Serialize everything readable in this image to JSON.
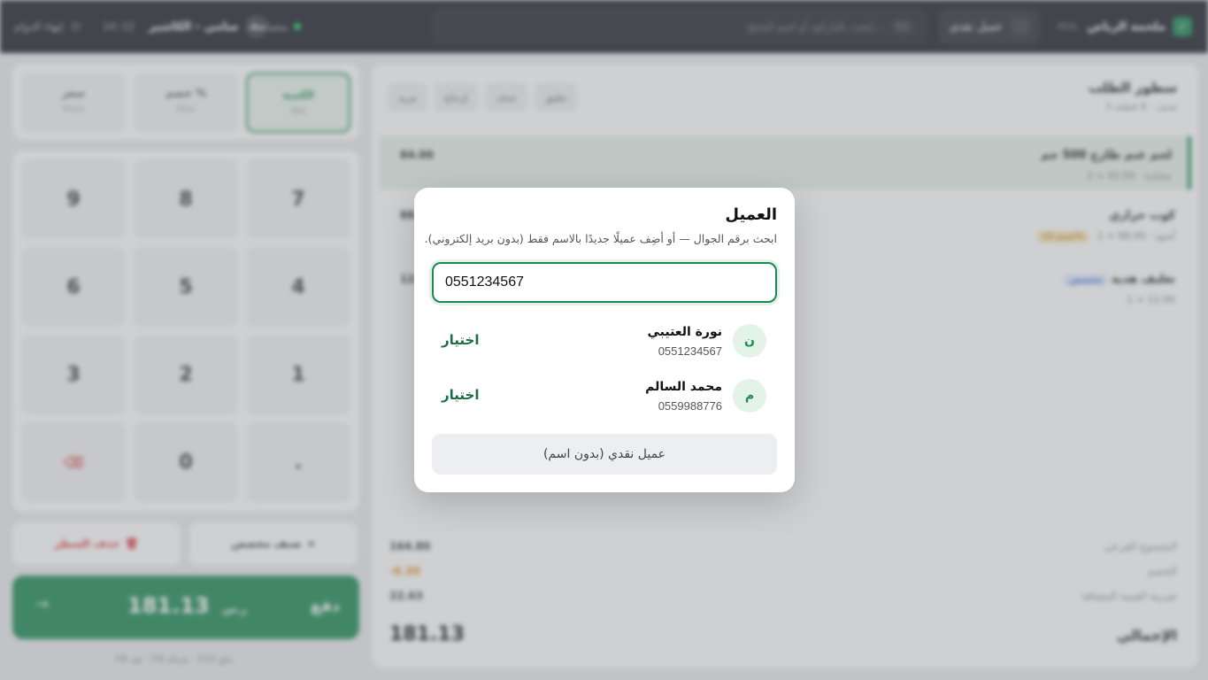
{
  "topbar": {
    "brand_name": "ملحمة الرياض",
    "brand_code": "POS",
    "customer_button": "عميل نقدي",
    "search_placeholder": "ابحث بالباركود أو اسم المنتج…",
    "search_shortcut": "F2",
    "status": "متصل",
    "cashier": "سامي - الكاشير",
    "cashier_initials": "سك",
    "clock": "14:12",
    "end_shift": "إنهاء الدوام"
  },
  "order": {
    "title": "سطور الطلب",
    "subtitle": "3 صنف · 6 قطعة",
    "actions": [
      "تعليق",
      "حذف",
      "إرجاع",
      "مزيد"
    ],
    "items": [
      {
        "name": "لحم غنم طازج 500 جم",
        "sub": "2 × 42.00 · مختارة",
        "price": "84.00"
      },
      {
        "name": "كوب حراري",
        "sub": "1 × 98.00 · أسود",
        "badge": "خصم 10%",
        "price": "88.20"
      },
      {
        "name": "تغليف هدية",
        "sub": "1 × 12.00",
        "badge": "مخصص",
        "price": "12.00"
      }
    ],
    "totals": [
      {
        "label": "المجموع الفرعي",
        "value": "164.80"
      },
      {
        "label": "الخصم",
        "value": "-6.30"
      },
      {
        "label": "ضريبة القيمة المضافة",
        "value": "22.63"
      }
    ],
    "grand_label": "الإجمالي",
    "grand_value": "181.13"
  },
  "modes": [
    {
      "label": "الكمية",
      "sub": "Qty"
    },
    {
      "label": "خصم %",
      "sub": "Disc"
    },
    {
      "label": "سعر",
      "sub": "Price"
    }
  ],
  "keypad": [
    "7",
    "8",
    "9",
    "4",
    "5",
    "6",
    "1",
    "2",
    "3",
    ".",
    "0",
    "⌫"
  ],
  "buttons": {
    "delete_line": "حذف السطر",
    "custom_item": "صنف مخصص",
    "pay_label": "دفع",
    "pay_amount": "181.13",
    "pay_currency": "ر.س"
  },
  "shortcuts": "F8 نقد · F9 شبكة · F10 دفع",
  "modal": {
    "title": "العميل",
    "description": "ابحث برقم الجوال — أو أضِف عميلًا جديدًا بالاسم فقط (بدون بريد إلكتروني).",
    "input_value": "0551234567",
    "results": [
      {
        "initial": "ن",
        "name": "نورة العتيبي",
        "phone": "0551234567",
        "action": "اختيار"
      },
      {
        "initial": "م",
        "name": "محمد السالم",
        "phone": "0559988776",
        "action": "اختيار"
      }
    ],
    "cash_customer_button": "عميل نقدي (بدون اسم)"
  },
  "colors": {
    "accent": "#1b8a52",
    "topbar": "#1c2026",
    "overlay": "#808388"
  }
}
